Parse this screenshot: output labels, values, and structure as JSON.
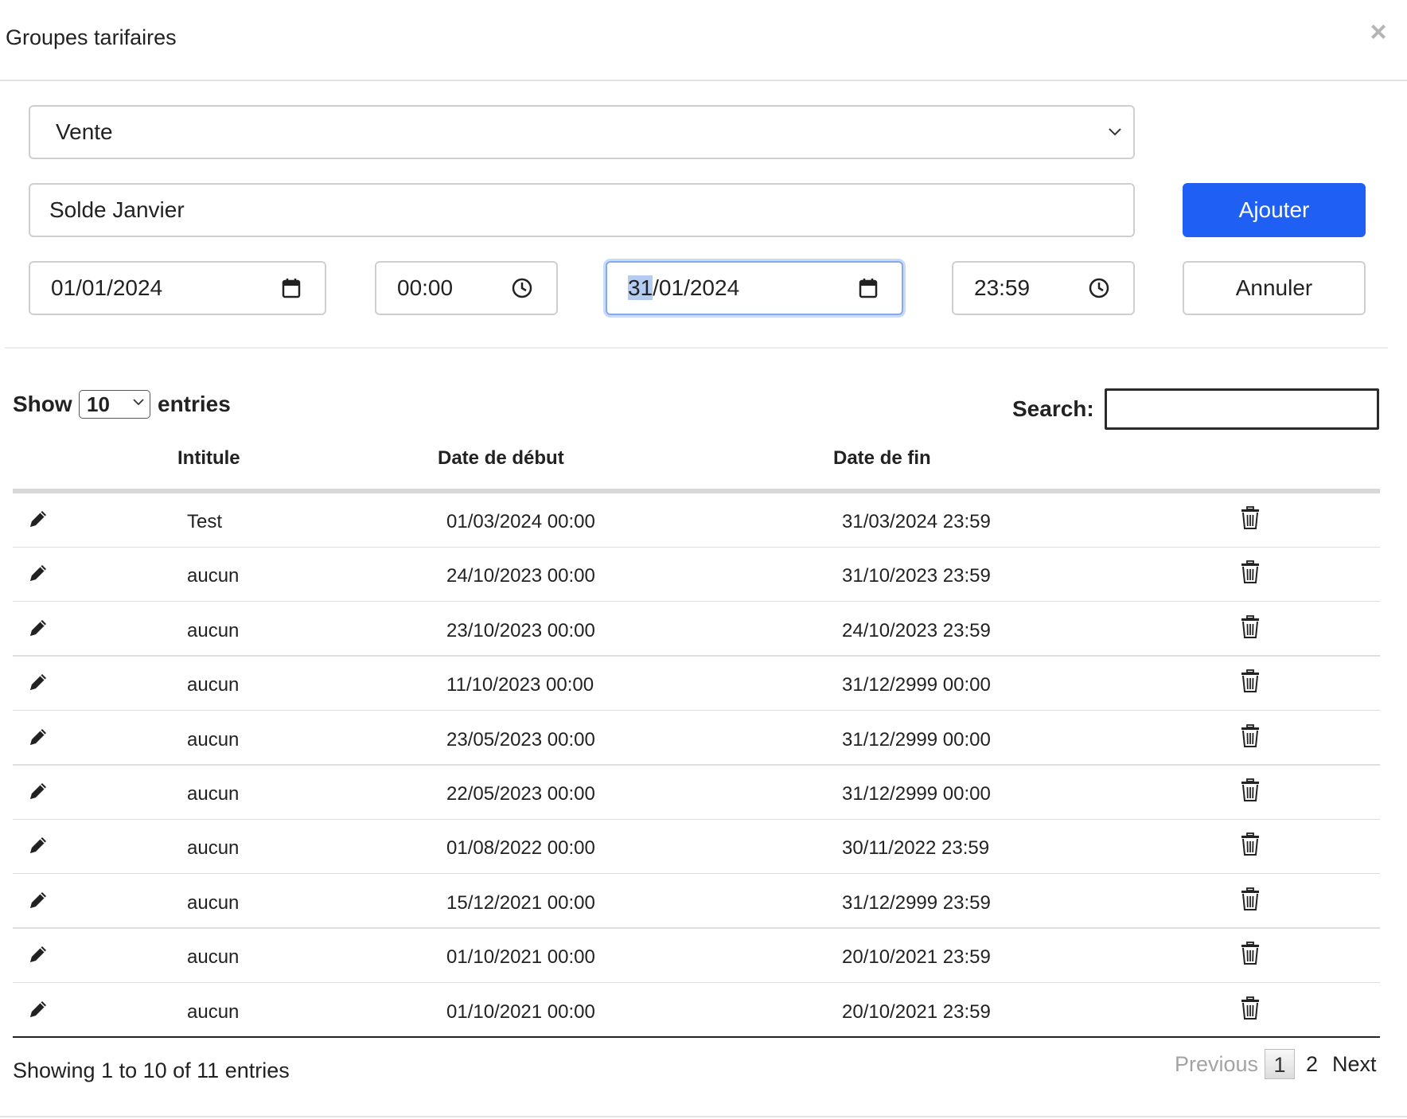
{
  "modal": {
    "title": "Groupes tarifaires",
    "close_icon": "close-icon"
  },
  "form": {
    "type_select": {
      "value": "Vente"
    },
    "name_input": {
      "value": "Solde Janvier"
    },
    "start_date": {
      "value": "01/01/2024"
    },
    "start_time": {
      "value": "00:00"
    },
    "end_date": {
      "day": "31",
      "rest": "/01/2024"
    },
    "end_time": {
      "value": "23:59"
    },
    "add_button": "Ajouter",
    "cancel_button": "Annuler",
    "colors": {
      "primary": "#1f5ff3",
      "focus_border": "#86a9e8"
    }
  },
  "table_controls": {
    "show_label": "Show",
    "length_value": "10",
    "entries_label": "entries",
    "search_label": "Search:",
    "search_value": ""
  },
  "table": {
    "columns": [
      "Intitule",
      "Date de début",
      "Date de fin"
    ],
    "rows": [
      {
        "intitule": "Test",
        "debut": "01/03/2024 00:00",
        "fin": "31/03/2024 23:59"
      },
      {
        "intitule": "aucun",
        "debut": "24/10/2023 00:00",
        "fin": "31/10/2023 23:59"
      },
      {
        "intitule": "aucun",
        "debut": "23/10/2023 00:00",
        "fin": "24/10/2023 23:59"
      },
      {
        "intitule": "aucun",
        "debut": "11/10/2023 00:00",
        "fin": "31/12/2999 00:00"
      },
      {
        "intitule": "aucun",
        "debut": "23/05/2023 00:00",
        "fin": "31/12/2999 00:00"
      },
      {
        "intitule": "aucun",
        "debut": "22/05/2023 00:00",
        "fin": "31/12/2999 00:00"
      },
      {
        "intitule": "aucun",
        "debut": "01/08/2022 00:00",
        "fin": "30/11/2022 23:59"
      },
      {
        "intitule": "aucun",
        "debut": "15/12/2021 00:00",
        "fin": "31/12/2999 23:59"
      },
      {
        "intitule": "aucun",
        "debut": "01/10/2021 00:00",
        "fin": "20/10/2021 23:59"
      },
      {
        "intitule": "aucun",
        "debut": "01/10/2021 00:00",
        "fin": "20/10/2021 23:59"
      }
    ]
  },
  "footer": {
    "info": "Showing 1 to 10 of 11 entries",
    "pagination": {
      "previous": "Previous",
      "current": "1",
      "page2": "2",
      "next": "Next"
    }
  }
}
